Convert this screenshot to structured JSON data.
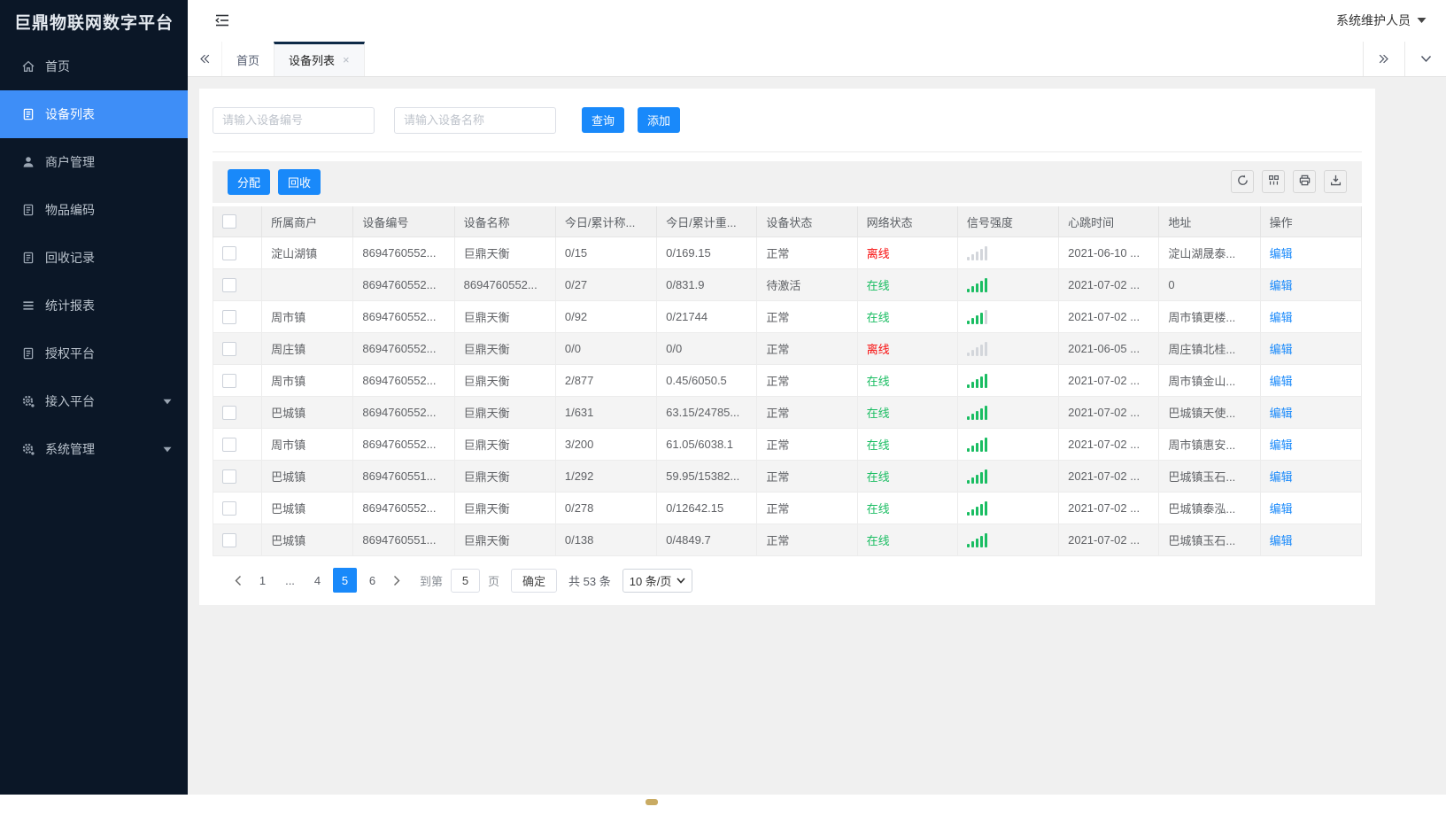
{
  "app": {
    "title": "巨鼎物联网数字平台",
    "user_label": "系统维护人员"
  },
  "colors": {
    "accent": "#1989fa",
    "sidebar_active": "#3e8ef7",
    "online_green": "#1abd62",
    "offline_red": "#f80d0d"
  },
  "sidebar": {
    "items": [
      {
        "label": "首页",
        "icon": "home-icon",
        "active": false,
        "caret": false
      },
      {
        "label": "设备列表",
        "icon": "doc-icon",
        "active": true,
        "caret": false
      },
      {
        "label": "商户管理",
        "icon": "user-icon",
        "active": false,
        "caret": false
      },
      {
        "label": "物品编码",
        "icon": "doc-icon",
        "active": false,
        "caret": false
      },
      {
        "label": "回收记录",
        "icon": "doc-icon",
        "active": false,
        "caret": false
      },
      {
        "label": "统计报表",
        "icon": "list-icon",
        "active": false,
        "caret": false
      },
      {
        "label": "授权平台",
        "icon": "doc-icon",
        "active": false,
        "caret": false
      },
      {
        "label": "接入平台",
        "icon": "gear-icon",
        "active": false,
        "caret": true
      },
      {
        "label": "系统管理",
        "icon": "gear-icon",
        "active": false,
        "caret": true
      }
    ]
  },
  "tabs": {
    "items": [
      {
        "label": "首页",
        "active": false,
        "closable": false
      },
      {
        "label": "设备列表",
        "active": true,
        "closable": true
      }
    ]
  },
  "search": {
    "device_no_placeholder": "请输入设备编号",
    "device_name_placeholder": "请输入设备名称",
    "query_label": "查询",
    "add_label": "添加"
  },
  "toolbar": {
    "assign_label": "分配",
    "recycle_label": "回收",
    "icons": [
      "refresh-icon",
      "columns-icon",
      "print-icon",
      "export-icon"
    ]
  },
  "table": {
    "columns": [
      "",
      "所属商户",
      "设备编号",
      "设备名称",
      "今日/累计称...",
      "今日/累计重...",
      "设备状态",
      "网络状态",
      "信号强度",
      "心跳时间",
      "地址",
      "操作"
    ],
    "rows": [
      {
        "merchant": "淀山湖镇",
        "device_no": "8694760552...",
        "device_name": "巨鼎天衡",
        "today_count": "0/15",
        "today_weight": "0/169.15",
        "device_status": "正常",
        "network_status": "离线",
        "online": false,
        "signal_level": 0,
        "heartbeat": "2021-06-10 ...",
        "address": "淀山湖晟泰...",
        "action": "编辑"
      },
      {
        "merchant": "",
        "device_no": "8694760552...",
        "device_name": "8694760552...",
        "today_count": "0/27",
        "today_weight": "0/831.9",
        "device_status": "待激活",
        "network_status": "在线",
        "online": true,
        "signal_level": 5,
        "heartbeat": "2021-07-02 ...",
        "address": "0",
        "action": "编辑"
      },
      {
        "merchant": "周市镇",
        "device_no": "8694760552...",
        "device_name": "巨鼎天衡",
        "today_count": "0/92",
        "today_weight": "0/21744",
        "device_status": "正常",
        "network_status": "在线",
        "online": true,
        "signal_level": 4,
        "heartbeat": "2021-07-02 ...",
        "address": "周市镇更楼...",
        "action": "编辑"
      },
      {
        "merchant": "周庄镇",
        "device_no": "8694760552...",
        "device_name": "巨鼎天衡",
        "today_count": "0/0",
        "today_weight": "0/0",
        "device_status": "正常",
        "network_status": "离线",
        "online": false,
        "signal_level": 0,
        "heartbeat": "2021-06-05 ...",
        "address": "周庄镇北桂...",
        "action": "编辑"
      },
      {
        "merchant": "周市镇",
        "device_no": "8694760552...",
        "device_name": "巨鼎天衡",
        "today_count": "2/877",
        "today_weight": "0.45/6050.5",
        "device_status": "正常",
        "network_status": "在线",
        "online": true,
        "signal_level": 5,
        "heartbeat": "2021-07-02 ...",
        "address": "周市镇金山...",
        "action": "编辑"
      },
      {
        "merchant": "巴城镇",
        "device_no": "8694760552...",
        "device_name": "巨鼎天衡",
        "today_count": "1/631",
        "today_weight": "63.15/24785...",
        "device_status": "正常",
        "network_status": "在线",
        "online": true,
        "signal_level": 5,
        "heartbeat": "2021-07-02 ...",
        "address": "巴城镇天使...",
        "action": "编辑"
      },
      {
        "merchant": "周市镇",
        "device_no": "8694760552...",
        "device_name": "巨鼎天衡",
        "today_count": "3/200",
        "today_weight": "61.05/6038.1",
        "device_status": "正常",
        "network_status": "在线",
        "online": true,
        "signal_level": 5,
        "heartbeat": "2021-07-02 ...",
        "address": "周市镇惠安...",
        "action": "编辑"
      },
      {
        "merchant": "巴城镇",
        "device_no": "8694760551...",
        "device_name": "巨鼎天衡",
        "today_count": "1/292",
        "today_weight": "59.95/15382...",
        "device_status": "正常",
        "network_status": "在线",
        "online": true,
        "signal_level": 5,
        "heartbeat": "2021-07-02 ...",
        "address": "巴城镇玉石...",
        "action": "编辑"
      },
      {
        "merchant": "巴城镇",
        "device_no": "8694760552...",
        "device_name": "巨鼎天衡",
        "today_count": "0/278",
        "today_weight": "0/12642.15",
        "device_status": "正常",
        "network_status": "在线",
        "online": true,
        "signal_level": 5,
        "heartbeat": "2021-07-02 ...",
        "address": "巴城镇泰泓...",
        "action": "编辑"
      },
      {
        "merchant": "巴城镇",
        "device_no": "8694760551...",
        "device_name": "巨鼎天衡",
        "today_count": "0/138",
        "today_weight": "0/4849.7",
        "device_status": "正常",
        "network_status": "在线",
        "online": true,
        "signal_level": 5,
        "heartbeat": "2021-07-02 ...",
        "address": "巴城镇玉石...",
        "action": "编辑"
      }
    ]
  },
  "pagination": {
    "pages": [
      "1",
      "...",
      "4",
      "5",
      "6"
    ],
    "active_page": "5",
    "goto_label": "到第",
    "goto_value": "5",
    "page_unit_label": "页",
    "confirm_label": "确定",
    "total_label": "共 53 条",
    "page_size_label": "10 条/页"
  }
}
